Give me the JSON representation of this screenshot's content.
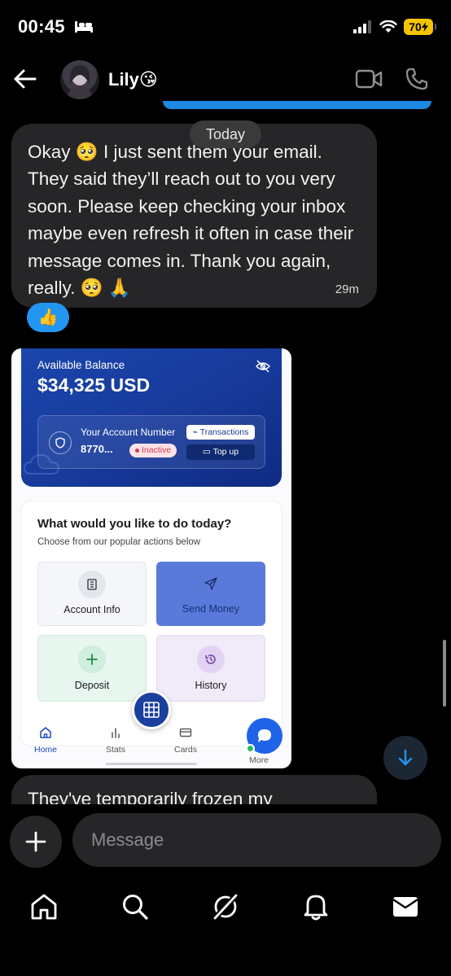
{
  "status_bar": {
    "time": "00:45",
    "battery": "70"
  },
  "header": {
    "contact_name": "Lily😘"
  },
  "messages": {
    "today_label": "Today",
    "message1": {
      "text": "Okay 🥺 I just sent them your email. They said they’ll reach out to you very soon. Please keep checking your inbox maybe even refresh it often in case their message comes in. Thank you again, really. 🥺 🙏",
      "time": "29m"
    },
    "reaction": "👍",
    "message2": {
      "text": "They've temporarily frozen my"
    }
  },
  "shared_image": {
    "balance_label": "Available Balance",
    "balance_amount": "$34,325 USD",
    "account_label": "Your Account Number",
    "account_number": "8770...",
    "status_badge": "Inactive",
    "transactions_button": "Transactions",
    "topup_button": "Top up",
    "actions_title": "What would you like to do today?",
    "actions_subtitle": "Choose from our popular actions below",
    "tiles": [
      "Account Info",
      "Send Money",
      "Deposit",
      "History"
    ],
    "nav": [
      "Home",
      "Stats",
      "Cards",
      "More"
    ]
  },
  "composer": {
    "placeholder": "Message"
  },
  "icons": {
    "back": "back-arrow-icon",
    "video": "video-camera-icon",
    "phone": "phone-icon",
    "plus": "plus-icon",
    "tabs": [
      "home-icon",
      "search-icon",
      "explore-icon",
      "bell-icon",
      "inbox-icon"
    ]
  },
  "colors": {
    "accent_blue": "#2196f3",
    "bubble": "#262628",
    "bank_blue": "#1b46ad"
  }
}
